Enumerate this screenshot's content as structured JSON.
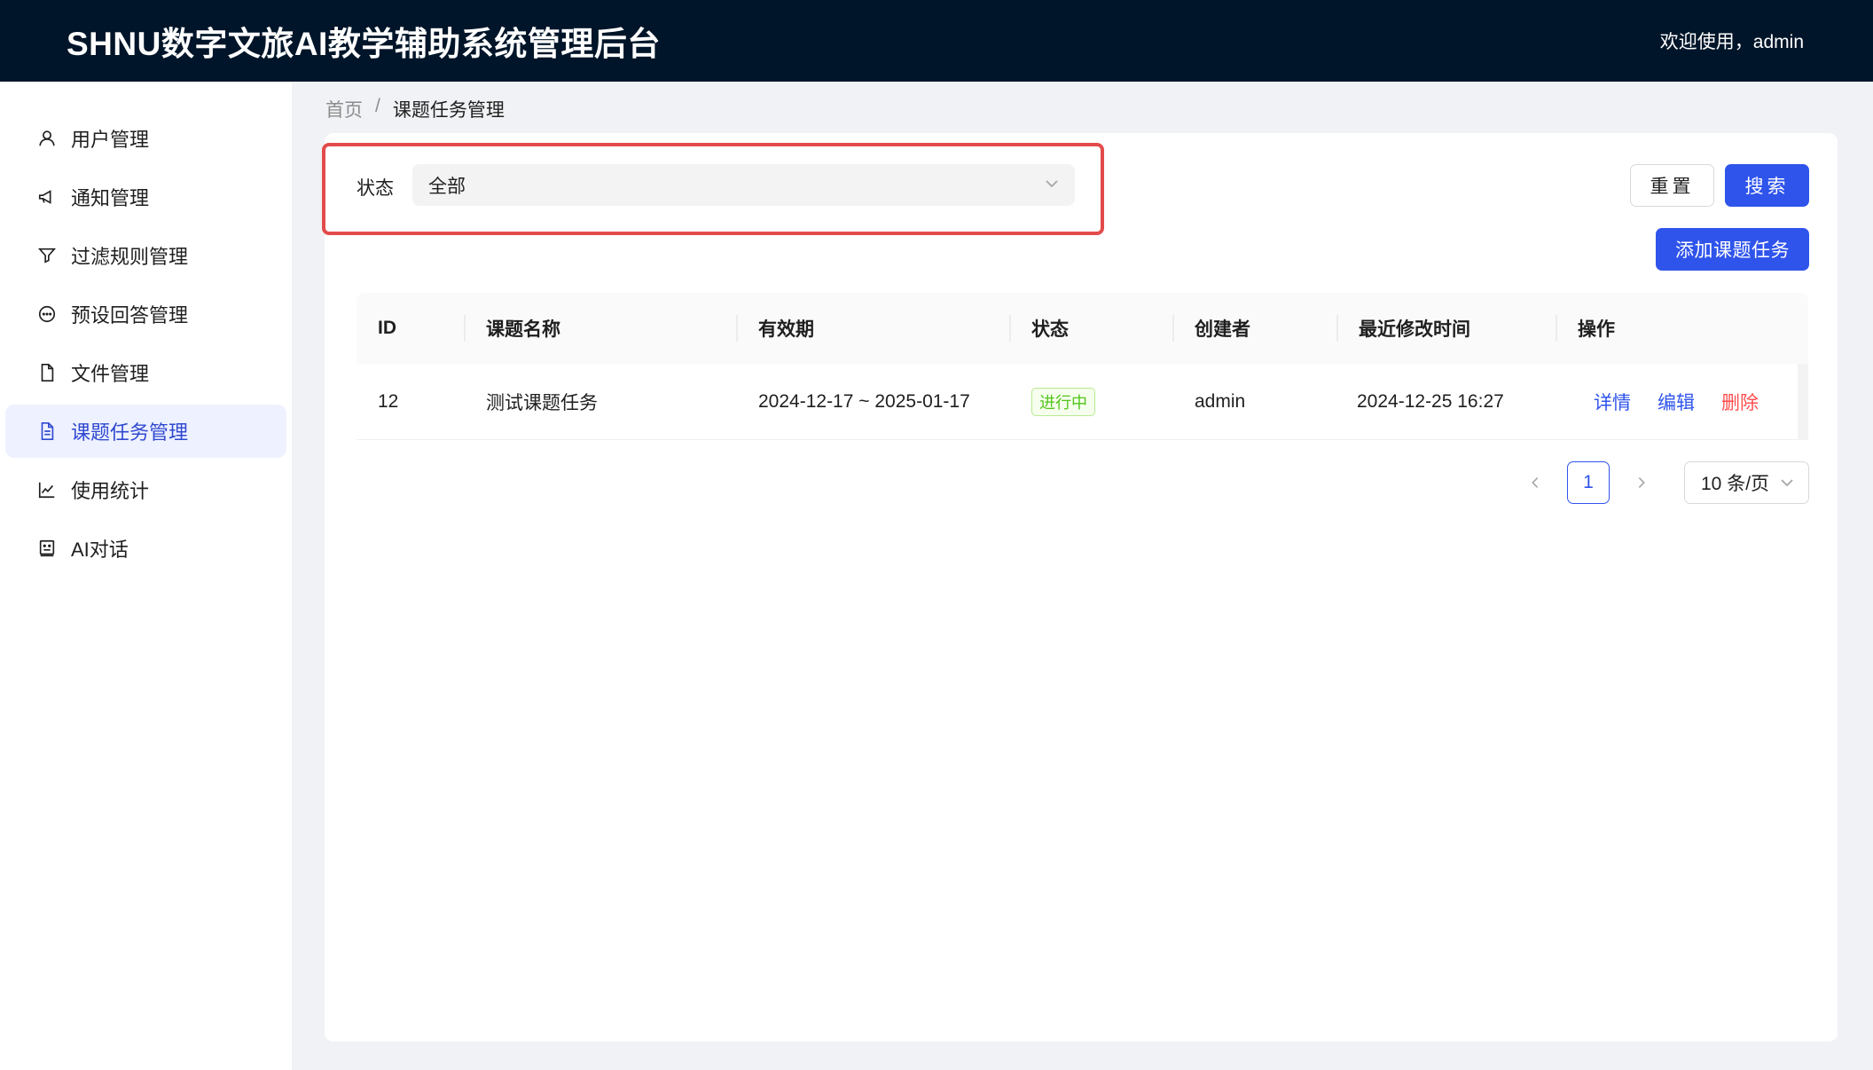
{
  "header": {
    "title": "SHNU数字文旅AI教学辅助系统管理后台",
    "welcome": "欢迎使用，admin"
  },
  "sidebar": {
    "items": [
      {
        "label": "用户管理",
        "icon": "user-icon"
      },
      {
        "label": "通知管理",
        "icon": "megaphone-icon"
      },
      {
        "label": "过滤规则管理",
        "icon": "filter-icon"
      },
      {
        "label": "预设回答管理",
        "icon": "chat-icon"
      },
      {
        "label": "文件管理",
        "icon": "file-icon"
      },
      {
        "label": "课题任务管理",
        "icon": "file-text-icon",
        "active": true
      },
      {
        "label": "使用统计",
        "icon": "line-chart-icon"
      },
      {
        "label": "AI对话",
        "icon": "robot-icon"
      }
    ]
  },
  "breadcrumb": {
    "home": "首页",
    "separator": "/",
    "current": "课题任务管理"
  },
  "filter": {
    "status_label": "状态",
    "status_value": "全部"
  },
  "buttons": {
    "reset": "重置",
    "search": "搜索",
    "add": "添加课题任务"
  },
  "table": {
    "columns": [
      "ID",
      "课题名称",
      "有效期",
      "状态",
      "创建者",
      "最近修改时间",
      "操作"
    ],
    "rows": [
      {
        "id": "12",
        "name": "测试课题任务",
        "period": "2024-12-17 ~ 2025-01-17",
        "status": "进行中",
        "creator": "admin",
        "modified": "2024-12-25 16:27",
        "actions": {
          "detail": "详情",
          "edit": "编辑",
          "delete": "删除"
        }
      }
    ]
  },
  "pagination": {
    "current_page": "1",
    "page_size": "10 条/页"
  },
  "colors": {
    "header_bg": "#001529",
    "primary": "#2f54eb",
    "danger": "#ff4d4f",
    "success": "#52c41a",
    "highlight_box": "#e34b4b"
  }
}
